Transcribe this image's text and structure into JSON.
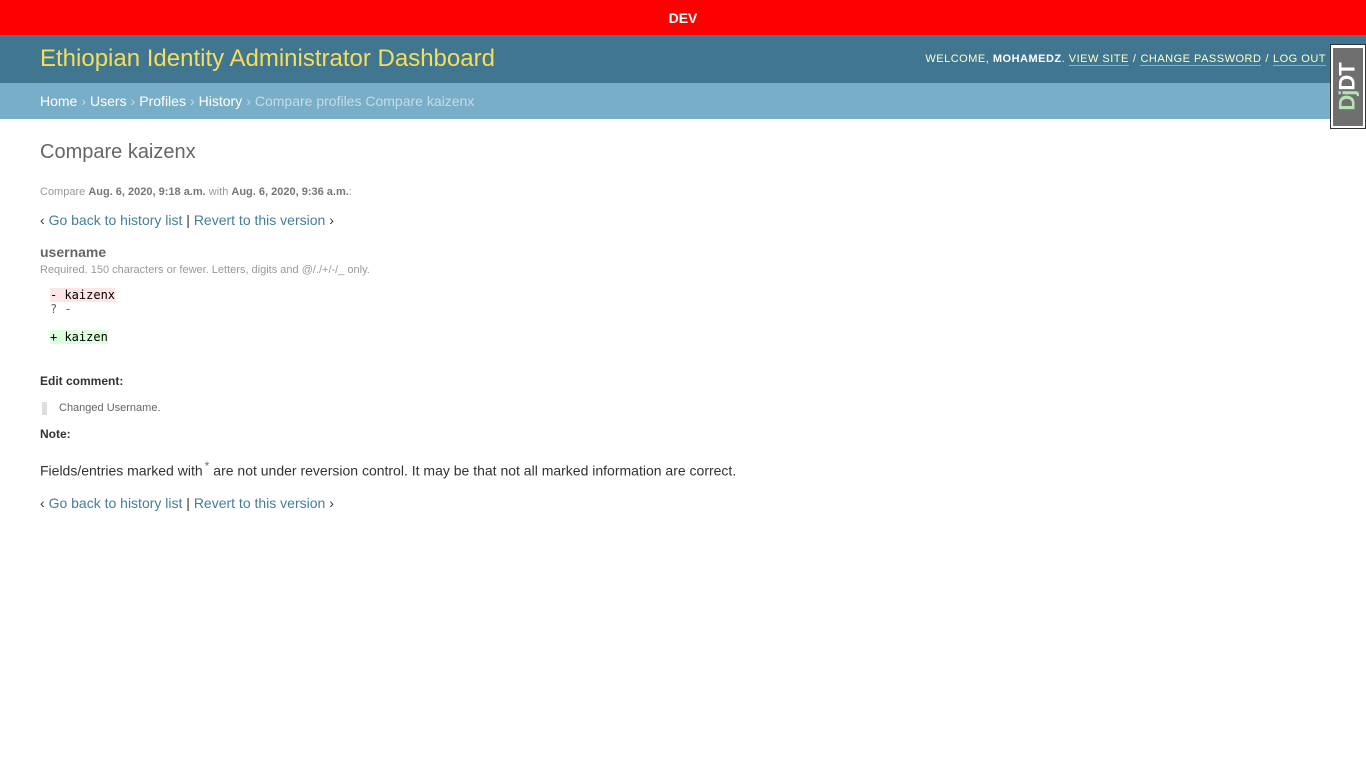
{
  "env_banner": "DEV",
  "header": {
    "title": "Ethiopian Identity Administrator Dashboard",
    "welcome": "WELCOME,",
    "username": "MOHAMEDZ",
    "view_site": "VIEW SITE",
    "change_password": "CHANGE PASSWORD",
    "log_out": "LOG OUT"
  },
  "breadcrumbs": {
    "home": "Home",
    "users": "Users",
    "profiles": "Profiles",
    "history": "History",
    "current": "Compare profiles Compare kaizenx"
  },
  "toolbar": {
    "dj": "Dj",
    "dt": "DT"
  },
  "page": {
    "title": "Compare kaizenx",
    "compare_word": "Compare",
    "date_from": "Aug. 6, 2020, 9:18 a.m.",
    "with_word": "with",
    "date_to": "Aug. 6, 2020, 9:36 a.m.",
    "back_link": "Go back to history list",
    "revert_link": "Revert to this version"
  },
  "field": {
    "name": "username",
    "help": "Required. 150 characters or fewer. Letters, digits and @/./+/-/_ only.",
    "diff_removed": "- kaizenx",
    "diff_hint": "? -",
    "diff_added": "+ kaizen"
  },
  "edit_comment": {
    "label": "Edit comment:",
    "text": "Changed Username."
  },
  "note": {
    "label": "Note:",
    "text_before": "Fields/entries marked with",
    "star": "*",
    "text_after": "are not under reversion control. It may be that not all marked information are correct."
  }
}
